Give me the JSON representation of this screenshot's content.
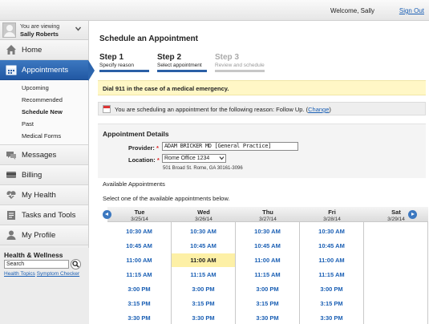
{
  "header": {
    "welcome": "Welcome, Sally",
    "sign_out": "Sign Out"
  },
  "sidebar": {
    "viewing_label": "You are viewing",
    "viewing_name": "Sally Roberts",
    "items": [
      {
        "label": "Home",
        "icon": "home-icon"
      },
      {
        "label": "Appointments",
        "icon": "calendar-icon"
      },
      {
        "label": "Messages",
        "icon": "messages-icon"
      },
      {
        "label": "Billing",
        "icon": "billing-icon"
      },
      {
        "label": "My Health",
        "icon": "heart-icon"
      },
      {
        "label": "Tasks and Tools",
        "icon": "tools-icon"
      },
      {
        "label": "My Profile",
        "icon": "profile-icon"
      }
    ],
    "sub_items": [
      "Upcoming",
      "Recommended",
      "Schedule New",
      "Past",
      "Medical Forms"
    ]
  },
  "health_wellness": {
    "title": "Health & Wellness",
    "search_value": "Search",
    "link_topics": "Health Topics",
    "link_checker": "Symptom Checker"
  },
  "main": {
    "title": "Schedule an Appointment",
    "steps": [
      {
        "number": "Step 1",
        "desc": "Specify reason"
      },
      {
        "number": "Step 2",
        "desc": "Select appointment"
      },
      {
        "number": "Step 3",
        "desc": "Review and schedule"
      }
    ],
    "emergency": "Dial 911 in the case of a medical emergency.",
    "reason_text": "You are scheduling an appointment for the following reason: Follow Up. (",
    "reason_change": "Change",
    "reason_close": ")",
    "details_title": "Appointment Details",
    "provider_label": "Provider:",
    "provider_value": "ADAM BRICKER MD [General Practice]",
    "location_label": "Location:",
    "location_value": "Rome Office 1234",
    "location_address": "501 Broad St. Rome, GA 30161-3096",
    "available_title": "Available Appointments",
    "select_prompt": "Select one of the available appointments below."
  },
  "calendar": {
    "days": [
      {
        "name": "Tue",
        "date": "3/25/14",
        "times": [
          "10:30 AM",
          "10:45 AM",
          "11:00 AM",
          "11:15 AM",
          "3:00 PM",
          "3:15 PM",
          "3:30 PM"
        ]
      },
      {
        "name": "Wed",
        "date": "3/26/14",
        "times": [
          "10:30 AM",
          "10:45 AM",
          "11:00 AM",
          "11:15 AM",
          "3:00 PM",
          "3:15 PM",
          "3:30 PM"
        ],
        "selected": "11:00 AM"
      },
      {
        "name": "Thu",
        "date": "3/27/14",
        "times": [
          "10:30 AM",
          "10:45 AM",
          "11:00 AM",
          "11:15 AM",
          "3:00 PM",
          "3:15 PM",
          "3:30 PM"
        ]
      },
      {
        "name": "Fri",
        "date": "3/28/14",
        "times": [
          "10:30 AM",
          "10:45 AM",
          "11:00 AM",
          "11:15 AM",
          "3:00 PM",
          "3:15 PM",
          "3:30 PM"
        ]
      },
      {
        "name": "Sat",
        "date": "3/29/14",
        "times": []
      }
    ],
    "selected_color": "#fdf0a6",
    "accent_color": "#2b5fa6"
  }
}
